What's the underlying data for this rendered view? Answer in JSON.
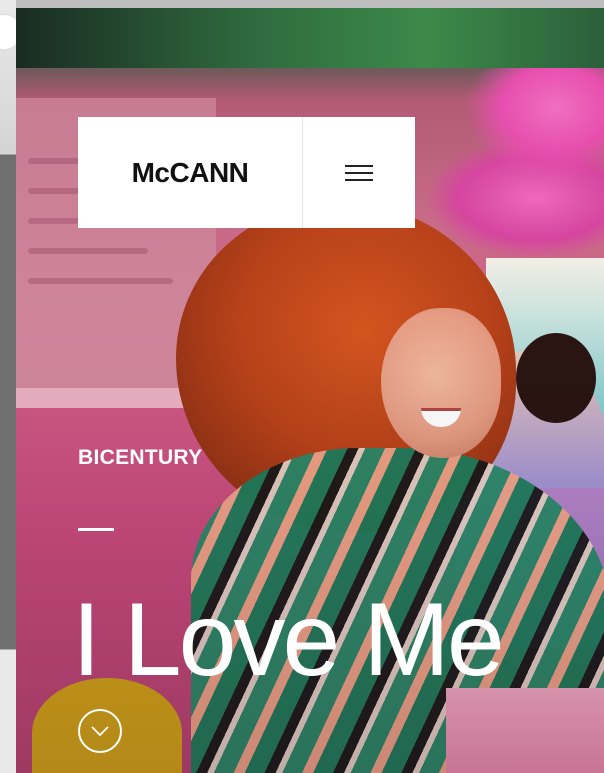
{
  "header": {
    "logo_text": "McCANN",
    "menu_icon": "hamburger-menu-icon"
  },
  "hero": {
    "kicker": "BICENTURY",
    "headline": "I Love Me",
    "scroll_icon": "chevron-down-icon"
  },
  "colors": {
    "header_bg": "#ffffff",
    "logo_color": "#111111",
    "overlay_text": "#ffffff",
    "accent_pink": "#e74fae"
  }
}
